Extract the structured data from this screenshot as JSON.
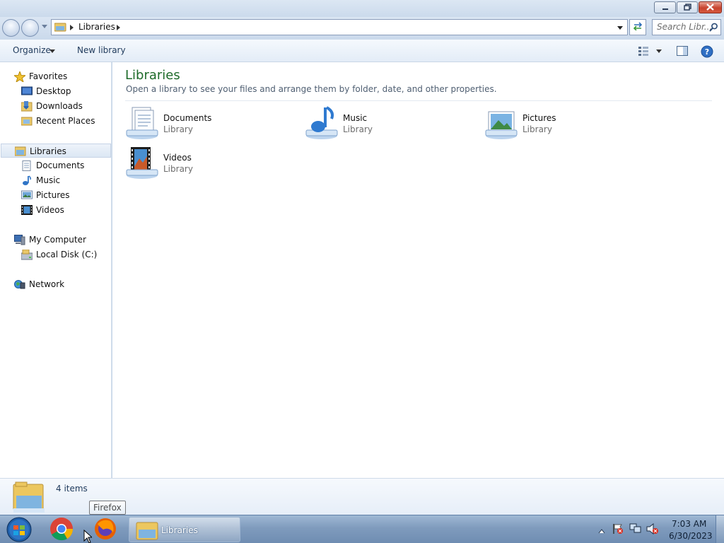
{
  "window": {
    "controls": {
      "minimize": "minimize",
      "maximize": "maximize",
      "close": "close"
    }
  },
  "address_bar": {
    "path": "Libraries",
    "icon": "libraries-folder-icon"
  },
  "search": {
    "placeholder": "Search Libr..."
  },
  "toolbar": {
    "organize_label": "Organize",
    "new_library_label": "New library"
  },
  "sidebar": {
    "favorites": {
      "label": "Favorites",
      "items": [
        {
          "label": "Desktop",
          "icon": "desktop-icon"
        },
        {
          "label": "Downloads",
          "icon": "downloads-icon"
        },
        {
          "label": "Recent Places",
          "icon": "recent-places-icon"
        }
      ]
    },
    "libraries": {
      "label": "Libraries",
      "items": [
        {
          "label": "Documents",
          "icon": "documents-icon"
        },
        {
          "label": "Music",
          "icon": "music-icon"
        },
        {
          "label": "Pictures",
          "icon": "pictures-icon"
        },
        {
          "label": "Videos",
          "icon": "videos-icon"
        }
      ]
    },
    "computer": {
      "label": "My Computer",
      "items": [
        {
          "label": "Local Disk (C:)",
          "icon": "hard-disk-icon"
        }
      ]
    },
    "network": {
      "label": "Network"
    }
  },
  "content": {
    "title": "Libraries",
    "subtitle": "Open a library to see your files and arrange them by folder, date, and other properties.",
    "libraries": [
      {
        "name": "Documents",
        "type": "Library",
        "icon": "documents-library-icon"
      },
      {
        "name": "Music",
        "type": "Library",
        "icon": "music-library-icon"
      },
      {
        "name": "Pictures",
        "type": "Library",
        "icon": "pictures-library-icon"
      },
      {
        "name": "Videos",
        "type": "Library",
        "icon": "videos-library-icon"
      }
    ]
  },
  "status": {
    "item_count": "4 items"
  },
  "taskbar": {
    "active_window": "Libraries",
    "tooltip": "Firefox",
    "time": "7:03 AM",
    "date": "6/30/2023"
  },
  "colors": {
    "title_green": "#1e6b2a",
    "link_blue": "#1e395b",
    "selection": "#dce7f4"
  }
}
